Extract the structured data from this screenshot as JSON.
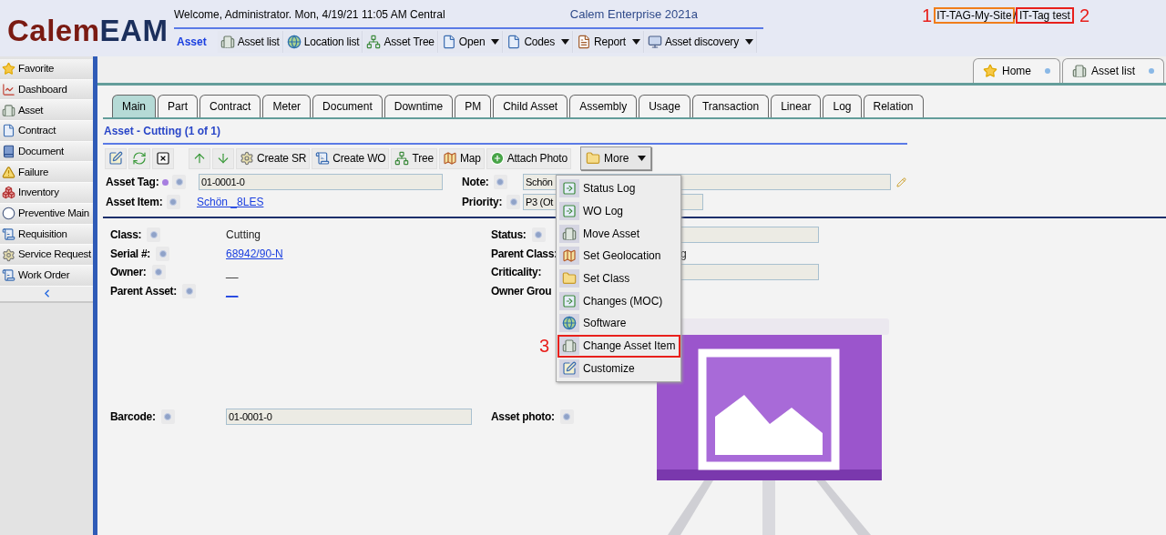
{
  "header": {
    "logo": [
      "Calem",
      "EAM"
    ],
    "welcome": "Welcome, Administrator. Mon, 4/19/21 11:05 AM Central",
    "product": "Calem Enterprise 2021a",
    "module": "Asset",
    "toolbar": [
      {
        "label": "Asset list",
        "dropdown": false
      },
      {
        "label": "Location list",
        "dropdown": false
      },
      {
        "label": "Asset Tree",
        "dropdown": false
      },
      {
        "label": "Open",
        "dropdown": true
      },
      {
        "label": "Codes",
        "dropdown": true
      },
      {
        "label": "Report",
        "dropdown": true
      },
      {
        "label": "Asset discovery",
        "dropdown": true
      }
    ]
  },
  "site_path": {
    "site_annotation": "1",
    "site": "IT-TAG-My-Site",
    "separator": "/",
    "tag": "IT-Tag test",
    "tag_annotation": "2"
  },
  "sidebar": {
    "items": [
      {
        "label": "Favorite"
      },
      {
        "label": "Dashboard"
      },
      {
        "label": "Asset"
      },
      {
        "label": "Contract"
      },
      {
        "label": "Document"
      },
      {
        "label": "Failure"
      },
      {
        "label": "Inventory"
      },
      {
        "label": "Preventive Main"
      },
      {
        "label": "Requisition"
      },
      {
        "label": "Service Request"
      },
      {
        "label": "Work Order"
      }
    ]
  },
  "open_tabs": [
    {
      "label": "Home"
    },
    {
      "label": "Asset list"
    }
  ],
  "tabs": [
    {
      "label": "Main",
      "selected": true
    },
    {
      "label": "Part",
      "selected": false
    },
    {
      "label": "Contract",
      "selected": false
    },
    {
      "label": "Meter",
      "selected": false
    },
    {
      "label": "Document",
      "selected": false
    },
    {
      "label": "Downtime",
      "selected": false
    },
    {
      "label": "PM",
      "selected": false
    },
    {
      "label": "Child Asset",
      "selected": false
    },
    {
      "label": "Assembly",
      "selected": false
    },
    {
      "label": "Usage",
      "selected": false
    },
    {
      "label": "Transaction",
      "selected": false
    },
    {
      "label": "Linear",
      "selected": false
    },
    {
      "label": "Log",
      "selected": false
    },
    {
      "label": "Relation",
      "selected": false
    }
  ],
  "record_title": "Asset - Cutting (1 of 1)",
  "actions": [
    {
      "label": "Create SR"
    },
    {
      "label": "Create WO"
    },
    {
      "label": "Tree"
    },
    {
      "label": "Map"
    },
    {
      "label": "Attach Photo"
    }
  ],
  "more_button": {
    "label": "More"
  },
  "header_fields": [
    {
      "label": "Asset Tag:",
      "required": true,
      "kind": "input",
      "value": "01-0001-0"
    },
    {
      "label": "Note:",
      "required": false,
      "kind": "input",
      "value": "Schön"
    },
    {
      "label": "Asset Item:",
      "required": false,
      "kind": "link",
      "value": "Schön _8LES"
    },
    {
      "label": "Priority:",
      "required": false,
      "kind": "input",
      "value": "P3 (Ot"
    }
  ],
  "details": [
    {
      "label": "Class:",
      "help": true,
      "kind": "text",
      "value": "Cutting"
    },
    {
      "label": "Status:",
      "help": true,
      "kind": "input"
    },
    {
      "label": "Serial #:",
      "help": true,
      "kind": "link",
      "value": "68942/90-N"
    },
    {
      "label": "Parent Class:",
      "help": false,
      "kind": "text",
      "value": "g"
    },
    {
      "label": "Owner:",
      "help": true,
      "kind": "text",
      "value": "__"
    },
    {
      "label": "Criticality:",
      "help": false,
      "kind": "input"
    },
    {
      "label": "Parent Asset:",
      "help": true,
      "kind": "link",
      "value": "__"
    },
    {
      "label": "Owner Grou",
      "help": false,
      "kind": "none"
    }
  ],
  "bottom_fields": [
    {
      "label": "Barcode:",
      "kind": "input",
      "value": "01-0001-0"
    },
    {
      "label": "Asset photo:",
      "kind": "none"
    }
  ],
  "more_menu": {
    "items": [
      {
        "label": "Status Log",
        "highlighted": false
      },
      {
        "label": "WO Log",
        "highlighted": false
      },
      {
        "label": "Move Asset",
        "highlighted": false
      },
      {
        "label": "Set Geolocation",
        "highlighted": false
      },
      {
        "label": "Set Class",
        "highlighted": false
      },
      {
        "label": "Changes (MOC)",
        "highlighted": false
      },
      {
        "label": "Software",
        "highlighted": false
      },
      {
        "label": "Change Asset Item",
        "highlighted": true,
        "annotation": "3"
      },
      {
        "label": "Customize",
        "highlighted": false
      }
    ]
  }
}
